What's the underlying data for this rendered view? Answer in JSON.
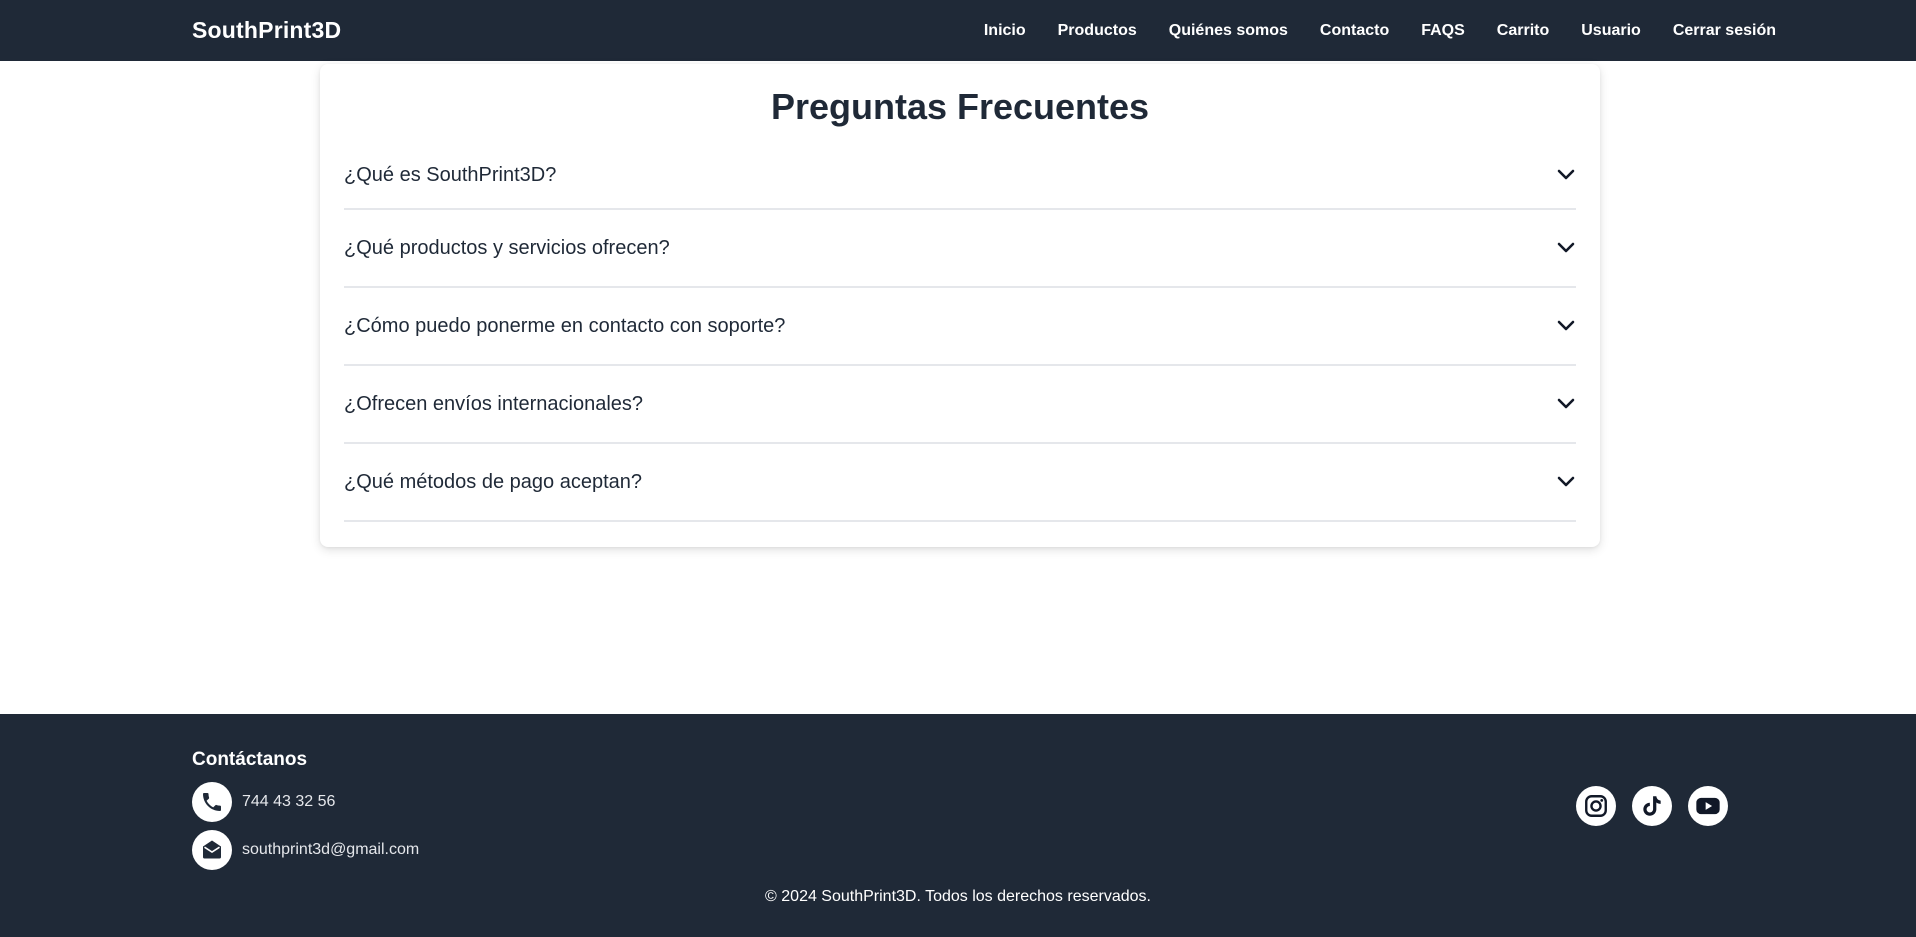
{
  "brand": "SouthPrint3D",
  "nav": {
    "items": [
      "Inicio",
      "Productos",
      "Quiénes somos",
      "Contacto",
      "FAQS",
      "Carrito",
      "Usuario",
      "Cerrar sesión"
    ]
  },
  "faq": {
    "title": "Preguntas Frecuentes",
    "questions": [
      "¿Qué es SouthPrint3D?",
      "¿Qué productos y servicios ofrecen?",
      "¿Cómo puedo ponerme en contacto con soporte?",
      "¿Ofrecen envíos internacionales?",
      "¿Qué métodos de pago aceptan?"
    ]
  },
  "footer": {
    "contact_title": "Contáctanos",
    "phone": "744 43 32 56",
    "email": "southprint3d@gmail.com",
    "socials": [
      "instagram-icon",
      "tiktok-icon",
      "youtube-icon"
    ],
    "copyright": "© 2024 SouthPrint3D. Todos los derechos reservados."
  },
  "colors": {
    "nav_bg": "#1f2937",
    "text_dark": "#1f2937",
    "divider": "#e5e7eb"
  }
}
